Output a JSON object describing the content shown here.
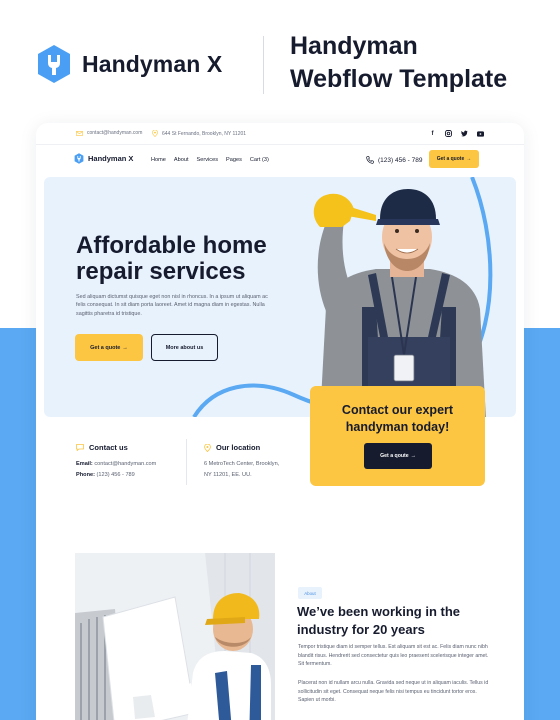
{
  "brand": {
    "name": "Handyman X",
    "title_line1": "Handyman",
    "title_line2": "Webflow Template",
    "color": "#4a9ff5"
  },
  "topbar": {
    "email": "contact@handyman.com",
    "address": "644 St Fernando, Brooklyn, NY 11201",
    "social": [
      "facebook-icon",
      "instagram-icon",
      "twitter-icon",
      "youtube-icon"
    ]
  },
  "nav": {
    "logo": "Handyman X",
    "links": [
      "Home",
      "About",
      "Services",
      "Pages",
      "Cart (3)"
    ],
    "phone": "(123) 456 - 789",
    "cta": "Get a quote",
    "cta_arrow": "→"
  },
  "hero": {
    "title": "Affordable home repair services",
    "text": "Sed aliquam dictumst quisque eget non nisl in rhoncus. In a ipsum ut aliquam ac felis consequat. In sit diam porta laoreet. Amet id magna diam in egestas. Nulla sagittis pharetra id tristique.",
    "btn_primary": "Get a quote",
    "btn_primary_arrow": "→",
    "btn_secondary": "More about us"
  },
  "expert": {
    "title": "Contact our expert handyman today!",
    "btn": "Get a qoute",
    "btn_arrow": "→"
  },
  "contact": {
    "heading": "Contact us",
    "email_label": "Email:",
    "email": "contact@handyman.com",
    "phone_label": "Phone:",
    "phone": "(123) 456 - 789"
  },
  "location": {
    "heading": "Our location",
    "line1": "6 MetroTech Center, Brooklyn,",
    "line2": "NY 11201, EE. UU."
  },
  "about": {
    "badge": "About",
    "title": "We’ve been working in the industry for 20 years",
    "p1": "Tempor tristique diam id semper tellus. Est aliquam sit est ac. Felis diam nunc nibh blandit risus. Hendrerit sed consectetur quis leo praesent scelerisque integer amet. Sit fermentum.",
    "p2": "Placerat non id nullam arcu nulla. Gravida sed neque ut in aliquam iaculis. Tellus id sollicitudin sit eget. Consequat neque felis nisi tempus eu tincidunt tortor eros. Sapien ut morbi."
  },
  "colors": {
    "accent_yellow": "#fcc542",
    "primary_blue": "#5aa9f2",
    "light_blue": "#e8f2fd",
    "dark": "#161b2e"
  }
}
